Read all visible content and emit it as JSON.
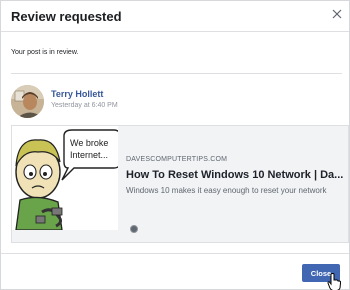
{
  "dialog": {
    "title": "Review requested",
    "status_text": "Your post is in review."
  },
  "post": {
    "author": "Terry Hollett",
    "timestamp": "Yesterday at 6:40 PM"
  },
  "link_preview": {
    "thumbnail_caption": [
      "We broke",
      "Internet..."
    ],
    "domain": "DAVESCOMPUTERTIPS.COM",
    "title": "How To Reset Windows 10 Network | Da...",
    "description": "Windows 10 makes it easy enough to reset your network"
  },
  "footer": {
    "close_label": "Close"
  },
  "colors": {
    "primary_button": "#4267b2",
    "author_link": "#385898"
  },
  "icons": [
    "close-icon",
    "avatar",
    "link-dot-icon",
    "hand-cursor-icon"
  ]
}
